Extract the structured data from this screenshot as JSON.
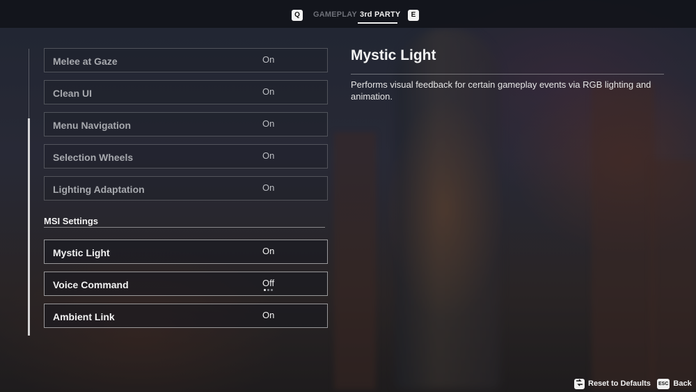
{
  "header": {
    "prev_key": "Q",
    "next_key": "E",
    "tabs": [
      {
        "label": "GAMEPLAY",
        "active": false
      },
      {
        "label": "3rd PARTY",
        "active": true
      }
    ]
  },
  "settings": {
    "rows_top": [
      {
        "label": "Melee at Gaze",
        "value": "On"
      },
      {
        "label": "Clean UI",
        "value": "On"
      },
      {
        "label": "Menu Navigation",
        "value": "On"
      },
      {
        "label": "Selection Wheels",
        "value": "On"
      },
      {
        "label": "Lighting Adaptation",
        "value": "On"
      }
    ],
    "section_title": "MSI Settings",
    "rows_msi": [
      {
        "label": "Mystic Light",
        "value": "On"
      },
      {
        "label": "Voice Command",
        "value": "Off"
      },
      {
        "label": "Ambient Link",
        "value": "On"
      }
    ]
  },
  "detail": {
    "title": "Mystic Light",
    "description": "Performs visual feedback for certain gameplay events via RGB lighting and animation."
  },
  "footer": {
    "reset_icon": "reset-arrows-icon",
    "reset_label": "Reset to Defaults",
    "back_key": "ESC",
    "back_label": "Back"
  }
}
